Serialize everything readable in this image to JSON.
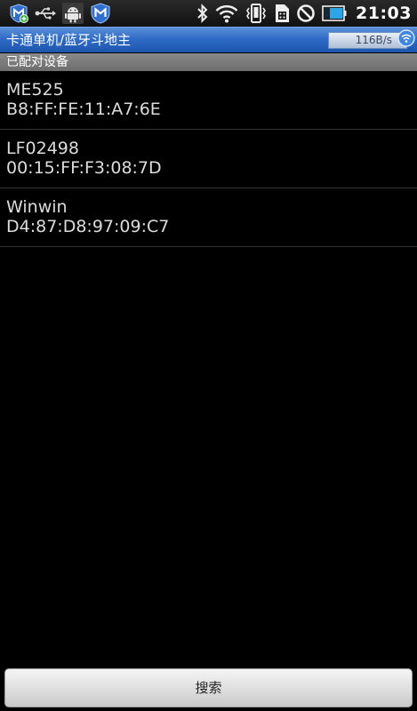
{
  "status_bar": {
    "time": "21:03",
    "left_icons": [
      "shield-notification-icon",
      "usb-icon",
      "android-debug-icon",
      "shield-icon"
    ],
    "right_icons": [
      "bluetooth-icon",
      "wifi-icon",
      "vibrate-icon",
      "sim-icon",
      "no-signal-icon",
      "battery-icon"
    ]
  },
  "app_bar": {
    "title": "卡通单机/蓝牙斗地主",
    "speed": "116B/s"
  },
  "section": {
    "header": "已配对设备"
  },
  "devices": [
    {
      "name": "ME525",
      "address": "B8:FF:FE:11:A7:6E"
    },
    {
      "name": "LF02498",
      "address": "00:15:FF:F3:08:7D"
    },
    {
      "name": "Winwin",
      "address": "D4:87:D8:97:09:C7"
    }
  ],
  "footer": {
    "search_label": "搜索"
  },
  "colors": {
    "title_bar": "#2f6cc7",
    "section_header": "#7a7a7a",
    "background": "#000000",
    "battery": "#2aa6e8"
  }
}
